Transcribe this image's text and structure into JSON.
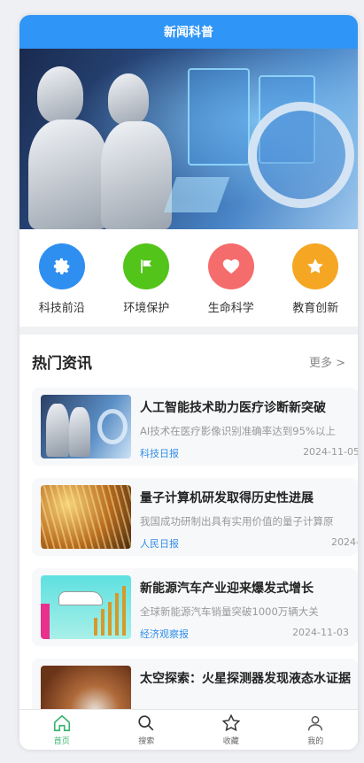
{
  "header": {
    "title": "新闻科普"
  },
  "categories": [
    {
      "label": "科技前沿",
      "icon": "gear-icon",
      "color": "#2e8ff0"
    },
    {
      "label": "环境保护",
      "icon": "flag-icon",
      "color": "#52c41a"
    },
    {
      "label": "生命科学",
      "icon": "heart-icon",
      "color": "#f56c6c"
    },
    {
      "label": "教育创新",
      "icon": "star-icon",
      "color": "#f5a623"
    }
  ],
  "news": {
    "title": "热门资讯",
    "more": "更多 >",
    "items": [
      {
        "title": "人工智能技术助力医疗诊断新突破",
        "summary": "AI技术在医疗影像识别准确率达到95%以上",
        "source": "科技日报",
        "date": "2024-11-05"
      },
      {
        "title": "量子计算机研发取得历史性进展",
        "summary": "我国成功研制出具有实用价值的量子计算原",
        "source": "人民日报",
        "date": "2024-"
      },
      {
        "title": "新能源汽车产业迎来爆发式增长",
        "summary": "全球新能源汽车销量突破1000万辆大关",
        "source": "经济观察报",
        "date": "2024-11-03"
      },
      {
        "title": "太空探索：火星探测器发现液态水证据"
      }
    ]
  },
  "tabbar": [
    {
      "label": "首页",
      "icon": "home-icon"
    },
    {
      "label": "搜索",
      "icon": "search-icon"
    },
    {
      "label": "收藏",
      "icon": "star-outline-icon"
    },
    {
      "label": "我的",
      "icon": "user-icon"
    }
  ]
}
